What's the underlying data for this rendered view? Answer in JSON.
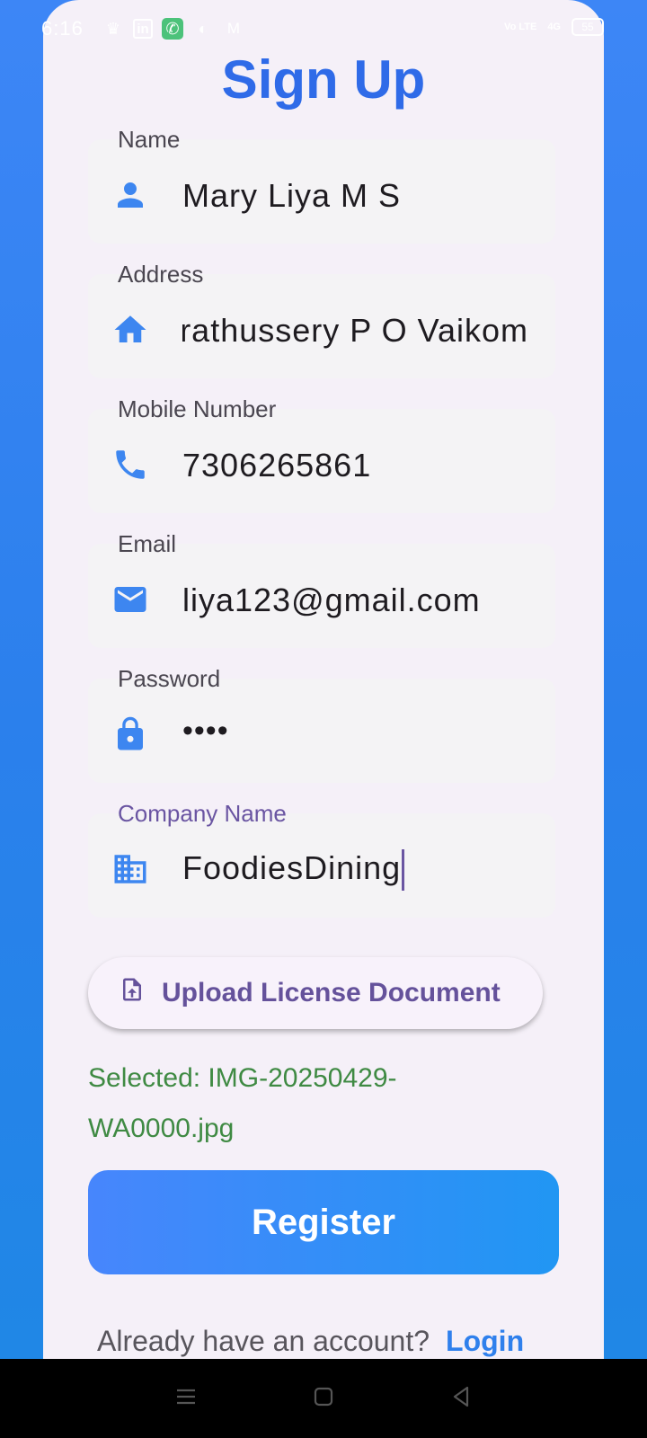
{
  "status_bar": {
    "time": "6:16",
    "left_icons": [
      "crown-icon",
      "linkedin-icon",
      "whatsapp-call-icon",
      "whatsapp-icon",
      "gmail-icon"
    ],
    "network_label": "Vo LTE",
    "signal_label": "4G",
    "battery": "55"
  },
  "page": {
    "title": "Sign Up"
  },
  "fields": {
    "name": {
      "label": "Name",
      "value": "Mary Liya M S",
      "icon": "person-icon"
    },
    "address": {
      "label": "Address",
      "value": "rathussery P O Vaikom",
      "icon": "home-icon"
    },
    "mobile": {
      "label": "Mobile Number",
      "value": "7306265861",
      "icon": "phone-icon"
    },
    "email": {
      "label": "Email",
      "value": "liya123@gmail.com",
      "icon": "mail-icon"
    },
    "password": {
      "label": "Password",
      "value": "••••",
      "icon": "lock-icon"
    },
    "company": {
      "label": "Company Name",
      "value": "FoodiesDining",
      "icon": "business-icon"
    }
  },
  "upload": {
    "label": "Upload License Document",
    "icon": "upload-file-icon",
    "selected_text": "Selected: IMG-20250429-WA0000.jpg"
  },
  "register": {
    "label": "Register"
  },
  "login": {
    "prompt": "Already have an account?",
    "link": "Login"
  },
  "colors": {
    "background": "#3d86f6",
    "card": "#f5f0f8",
    "title": "#2f6be8",
    "icon": "#3d86f0",
    "focus": "#6a55a2",
    "success": "#3f8a43"
  }
}
